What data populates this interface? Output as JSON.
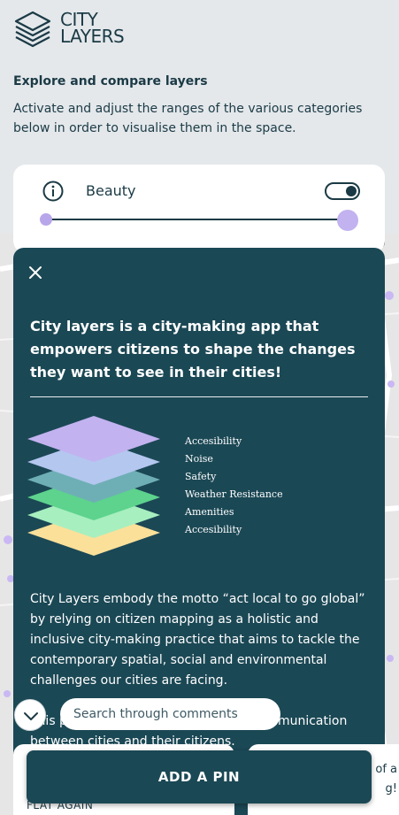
{
  "app": {
    "logo_line1": "CITY",
    "logo_line2": "LAYERS"
  },
  "intro": {
    "title": "Explore and compare layers",
    "description": "Activate and adjust the ranges of the various categories below in order to visualise them in the space."
  },
  "layer_card": {
    "name": "Beauty",
    "enabled": true,
    "range": [
      0,
      1
    ]
  },
  "modal": {
    "title": "City layers is a city-making app that empowers citizens to shape the changes they want to see in their cities!",
    "legend": [
      "Accesibility",
      "Noise",
      "Safety",
      "Weather Resistance",
      "Amenities",
      "Accesibility"
    ],
    "body_p1": "City Layers embody the motto “act local to go global” by relying on citizen mapping as a holistic and inclusive city-making practice that aims to tackle the contemporary spatial, social and environmental challenges our cities are facing.",
    "body_p2": "This platform serves as a means of communication between cities and their citizens."
  },
  "search": {
    "placeholder": "Search through comments"
  },
  "comments": {
    "left_peek": "FLAT AGAIN",
    "right_peek": "t of a g!"
  },
  "actions": {
    "add_pin_label": "ADD A PIN"
  },
  "colors": {
    "primary": "#1b4855",
    "background": "#e4e8eb",
    "layer_purple": "#c2b2f0",
    "layer_blue": "#b4c7ef",
    "layer_teal": "#6eafb5",
    "layer_green": "#5dd38d",
    "layer_mint": "#a7efbf",
    "layer_yellow": "#fbe09a"
  },
  "icons": [
    "logo-icon",
    "info-icon",
    "close-icon",
    "chevron-down-icon"
  ]
}
